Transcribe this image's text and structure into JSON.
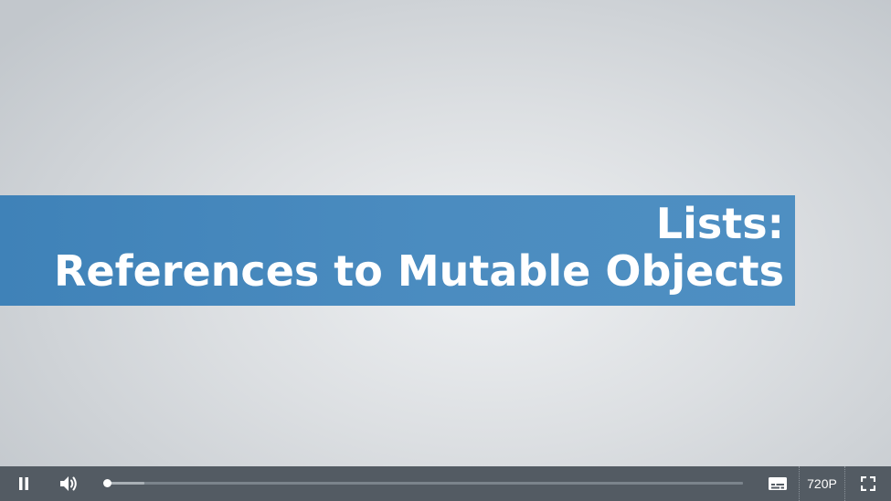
{
  "video": {
    "title_line1": "Lists:",
    "title_line2": "References to Mutable Objects",
    "band_color": "#4b8cc0"
  },
  "controls": {
    "state": "playing",
    "quality_label": "720P",
    "progress_fraction": 0.001,
    "buffered_fraction": 0.06,
    "icons": [
      "pause-icon",
      "volume-icon",
      "captions-icon",
      "fullscreen-icon"
    ],
    "bar_color": "#535b63"
  }
}
